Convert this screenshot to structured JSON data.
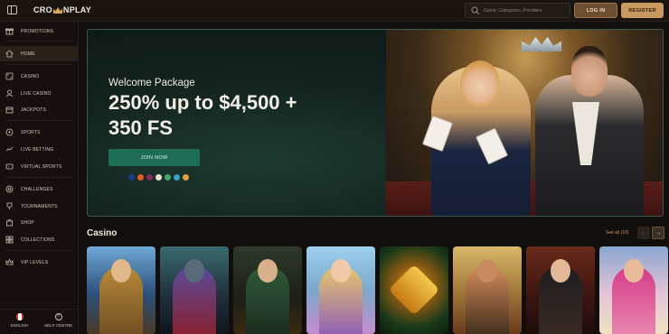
{
  "header": {
    "logo_text_left": "CRO",
    "logo_text_right": "NPLAY",
    "search_placeholder": "Game, Categories, Providers",
    "login_label": "LOG IN",
    "register_label": "REGISTER"
  },
  "sidebar": {
    "items": [
      {
        "label": "PROMOTIONS",
        "icon": "gift-icon"
      },
      {
        "label": "HOME",
        "icon": "home-icon",
        "active": true
      },
      {
        "label": "CASINO",
        "icon": "casino-icon"
      },
      {
        "label": "LIVE CASINO",
        "icon": "live-casino-icon"
      },
      {
        "label": "JACKPOTS",
        "icon": "jackpot-icon"
      },
      {
        "label": "SPORTS",
        "icon": "sports-icon"
      },
      {
        "label": "LIVE BETTING",
        "icon": "live-betting-icon"
      },
      {
        "label": "VIRTUAL SPORTS",
        "icon": "virtual-sports-icon"
      },
      {
        "label": "CHALLENGES",
        "icon": "challenges-icon"
      },
      {
        "label": "TOURNAMENTS",
        "icon": "tournaments-icon"
      },
      {
        "label": "SHOP",
        "icon": "shop-icon"
      },
      {
        "label": "COLLECTIONS",
        "icon": "collections-icon"
      },
      {
        "label": "VIP LEVELS",
        "icon": "vip-icon"
      }
    ],
    "footer": {
      "language_label": "ENGLISH",
      "help_label": "HELP CENTRE"
    }
  },
  "banner": {
    "kicker": "Welcome Package",
    "title": "250% up to $4,500 + 350 FS",
    "cta_label": "JOIN NOW",
    "payment_icons": [
      "visa-icon",
      "mastercard-icon",
      "skrill-icon",
      "bitcoin-icon",
      "ethereum-icon",
      "neteller-icon",
      "crypto-icon"
    ]
  },
  "casino": {
    "title": "Casino",
    "see_all_label": "See all (10)"
  },
  "colors": {
    "accent": "#c89a60",
    "cta_green": "#1f6d57",
    "background": "#120e0c"
  }
}
